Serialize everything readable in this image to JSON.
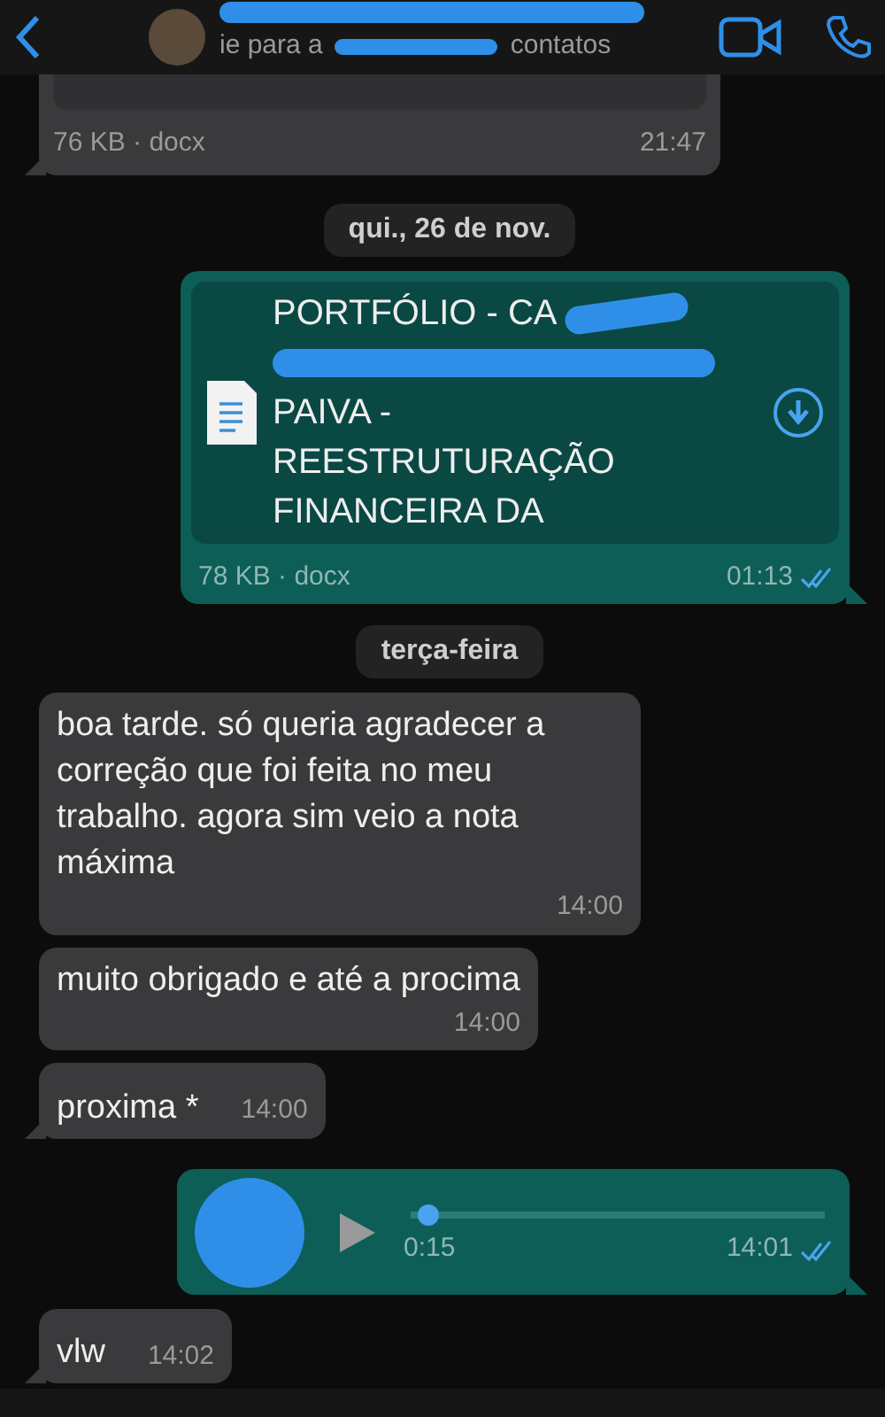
{
  "header": {
    "subtitle_parts": [
      "ie para a",
      "contatos"
    ]
  },
  "messages": [
    {
      "kind": "document_tail",
      "outgoing": false,
      "meta": "76 KB · docx",
      "time": "21:47"
    },
    {
      "kind": "date",
      "text": "qui., 26 de nov."
    },
    {
      "kind": "document",
      "outgoing": true,
      "title_lines": [
        "PORTFÓLIO - CA",
        "PAIVA -",
        "REESTRUTURAÇÃO",
        "FINANCEIRA DA"
      ],
      "meta": "78 KB · docx",
      "time": "01:13",
      "read": true
    },
    {
      "kind": "date",
      "text": "terça-feira"
    },
    {
      "kind": "text",
      "outgoing": false,
      "text": "boa tarde. só queria agradecer a correção que foi feita no meu trabalho. agora sim veio a nota máxima",
      "time": "14:00",
      "tail": false
    },
    {
      "kind": "text",
      "outgoing": false,
      "text": "muito obrigado e até a procima",
      "time": "14:00",
      "tail": false
    },
    {
      "kind": "text",
      "outgoing": false,
      "text": "proxima *",
      "time": "14:00",
      "tail": true
    },
    {
      "kind": "voice",
      "outgoing": true,
      "duration": "0:15",
      "time": "14:01",
      "read": true,
      "level": 0.02
    },
    {
      "kind": "text",
      "outgoing": false,
      "text": "vlw",
      "time": "14:02",
      "tail": true
    }
  ]
}
